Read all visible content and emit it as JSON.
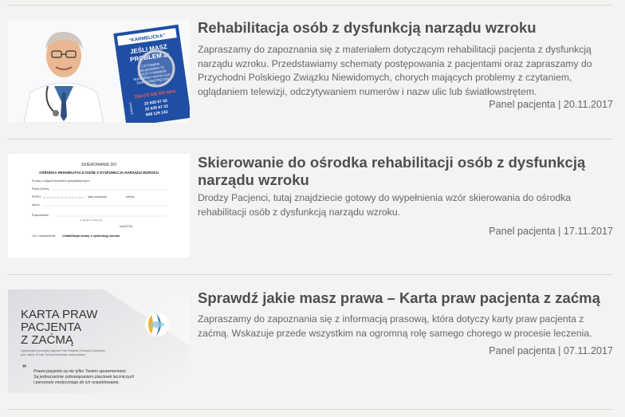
{
  "articles": [
    {
      "title": "Rehabilitacja osób z dysfunkcją narządu wzroku",
      "excerpt": "Zapraszamy do zapoznania się z materiałem dotyczącym rehabilitacji pacjenta z dysfunkcją narządu wzroku. Przedstawiamy schematy postępowania z pacjentami oraz zapraszamy do Przychodni Polskiego Związku Niewidomych, chorych mających problemy z czytaniem, oglądaniem telewizji, odczytywaniem numerów i nazw ulic lub światłowstrętem.",
      "category": "Panel pacjenta",
      "separator": " | ",
      "date": "20.11.2017",
      "thumb": {
        "brand": "\"KARMELICKA\"",
        "line1": "JEŚLI MASZ",
        "line2": "PROBLEM Z:",
        "small": [
          "CZYTANIEM,",
          "OGLĄDANIEM TV,",
          "ODCZYTYWANIEM",
          "NUMERÓW I NAZW ULIC,",
          "ŚWIATŁOWSTRĘTEM,",
          "ITP."
        ],
        "cta": "ZGŁOŚ SIĘ DO NAS",
        "phones": [
          "22 635 67 02",
          "22 635 67 33",
          "608 129 143"
        ],
        "side": "Zadzwoń:"
      }
    },
    {
      "title": "Skierowanie do ośrodka rehabilitacji osób z dysfunkcją narządu wzroku",
      "excerpt": "Drodzy Pacjenci, tutaj znajdziecie gotowy do wypełnienia wzór skierowania do ośrodka rehabilitacji osób z dysfunkcją narządu wzroku.",
      "category": "Panel pacjenta",
      "separator": " | ",
      "date": "17.11.2017",
      "thumb": {
        "heading": "SKIEROWANIE DO",
        "subheading": "OŚRODKA REHABILITACJI OSÓB Z DYSFUNKCJĄ NARZĄDU WZROKU",
        "row1": "Proszę o objęcie leczeniem specjalistycznym:",
        "row2": "Pana(-)Panią",
        "row3a": "PESEL",
        "row3b": "data urodzenia",
        "row3c": "telefon",
        "row4": "Adres",
        "row5": "Rozpoznanie",
        "row6": "(z ujęciem problemu)",
        "row7": "kod(ICD10)",
        "row8a": "Cel / uzasadnienie",
        "row8b": "rehabilitacja osoby z dysfunkcją wzroku"
      }
    },
    {
      "title": "Sprawdź jakie masz prawa – Karta praw pacjenta z zaćmą",
      "excerpt": "Zapraszamy do zapoznania się z informacją prasową, która dotyczy karty praw pacjenta z zaćmą. Wskazuje przede wszystkim na ogromną rolę samego chorego w procesie leczenia.",
      "category": "Panel pacjenta",
      "separator": " | ",
      "date": "07.11.2017",
      "thumb": {
        "line1": "KARTA PRAW",
        "line2": "PACJENTA",
        "line3": "Z ZAĆMĄ",
        "note1": "Opracowanie pod egidą Instytutu Praw Pacjenta i Edukacji Zdrowotnej",
        "note2": "prof. nadzw. dr hab. Dorota Karkowska, radca prawny",
        "quote1": "Prawa pacjenta są nie tylko Twoimi uprawnieniami.",
        "quote2": "Są jednocześnie zobowiązaniem placówek leczniczych",
        "quote3": "i personelu medycznego do ich respektowania.",
        "qmark": "❞"
      }
    }
  ]
}
